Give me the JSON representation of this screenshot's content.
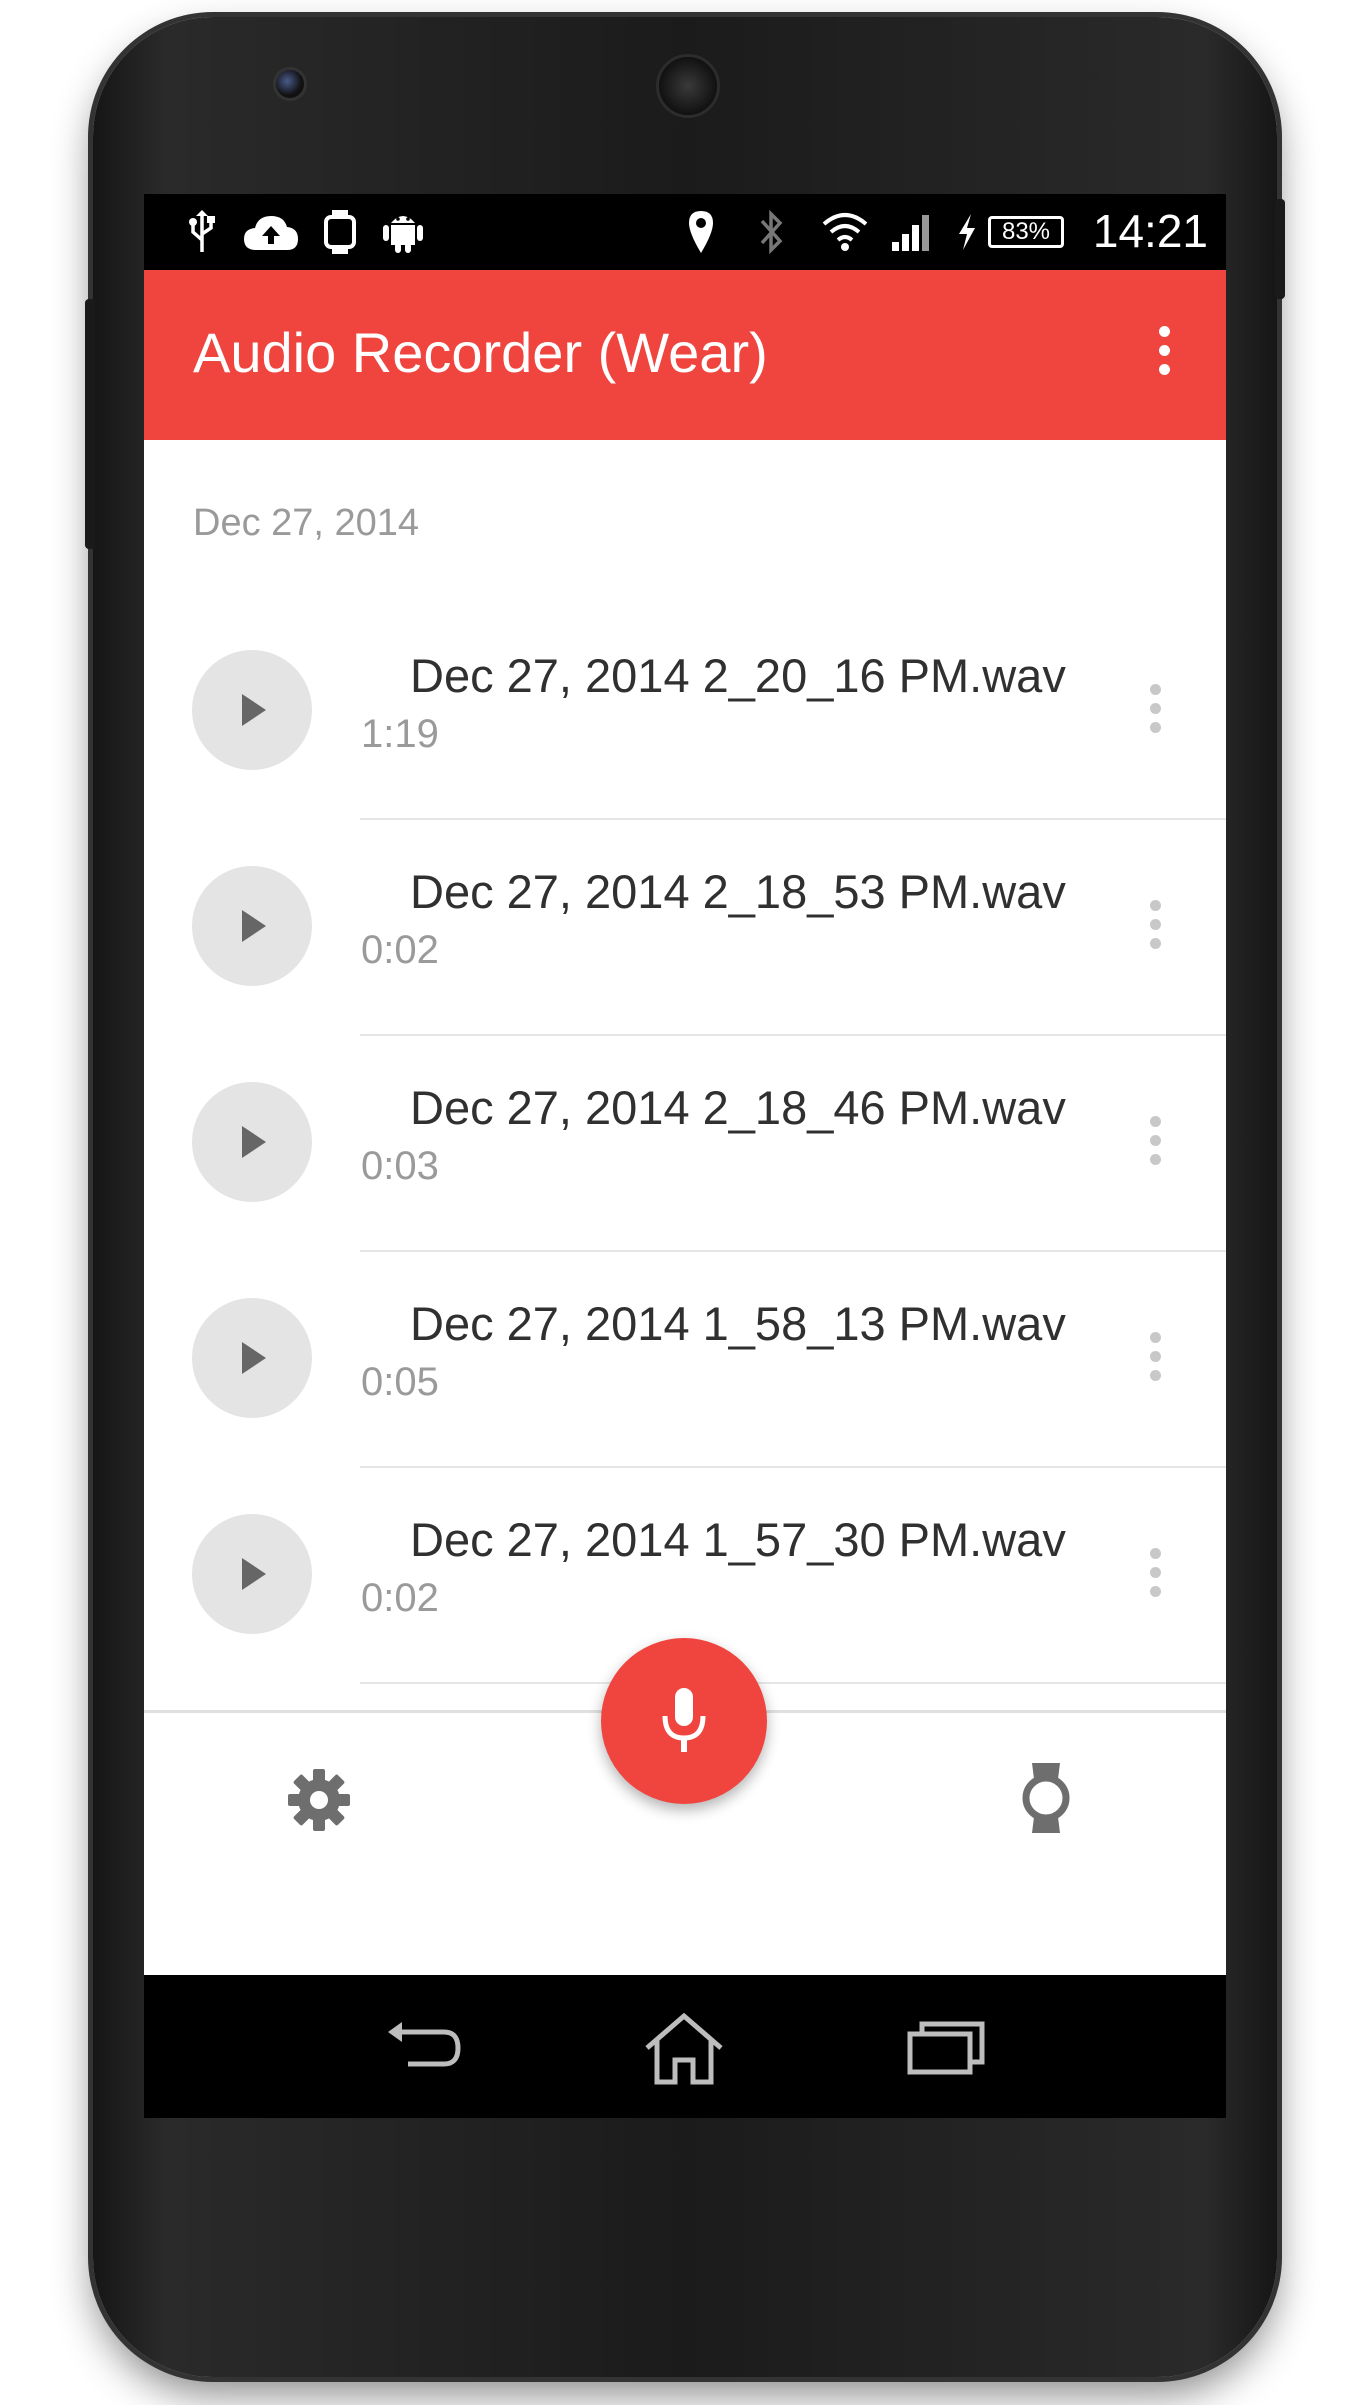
{
  "status_bar": {
    "icons": [
      "usb-icon",
      "cloud-upload-icon",
      "watch-icon",
      "android-icon",
      "location-icon",
      "bluetooth-icon",
      "wifi-icon",
      "signal-icon",
      "charging-icon"
    ],
    "battery": "83%",
    "time": "14:21"
  },
  "app_bar": {
    "title": "Audio Recorder (Wear)",
    "menu_icon": "more-vert-icon"
  },
  "section_header": "Dec 27, 2014",
  "recordings": [
    {
      "name": "Dec 27, 2014 2_20_16 PM.wav",
      "duration": "1:19"
    },
    {
      "name": "Dec 27, 2014 2_18_53 PM.wav",
      "duration": "0:02"
    },
    {
      "name": "Dec 27, 2014 2_18_46 PM.wav",
      "duration": "0:03"
    },
    {
      "name": "Dec 27, 2014 1_58_13 PM.wav",
      "duration": "0:05"
    },
    {
      "name": "Dec 27, 2014 1_57_30 PM.wav",
      "duration": "0:02"
    }
  ],
  "bottom_bar": {
    "left_icon": "settings-icon",
    "fab_icon": "microphone-icon",
    "right_icon": "watch-icon"
  },
  "nav_bar": {
    "icons": [
      "back-icon",
      "home-icon",
      "recents-icon"
    ]
  },
  "colors": {
    "accent": "#f0453e",
    "primary_text": "#303030",
    "secondary_text": "#9a9a9a"
  }
}
